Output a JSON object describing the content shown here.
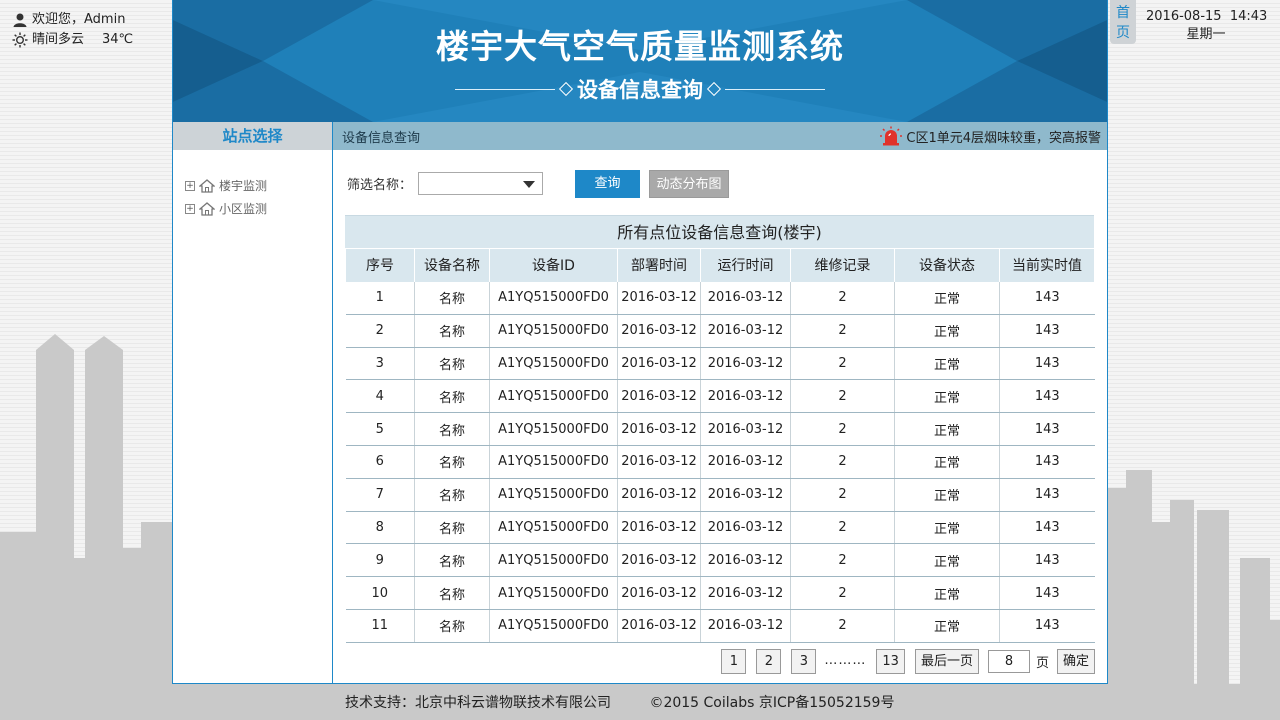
{
  "user": {
    "greeting": "欢迎您，Admin",
    "weather": "晴间多云",
    "temperature": "34℃"
  },
  "clock": {
    "datetime": "2016-08-15  14:43",
    "weekday": "星期一"
  },
  "home_button": {
    "line1": "首",
    "line2": "页"
  },
  "banner": {
    "title": "楼宇大气空气质量监测系统",
    "subtitle": "设备信息查询"
  },
  "sidebar": {
    "title": "站点选择",
    "items": [
      {
        "label": "楼宇监测"
      },
      {
        "label": "小区监测"
      }
    ]
  },
  "main": {
    "header_title": "设备信息查询",
    "alarm_text": "C区1单元4层烟味较重，突高报警",
    "filter_label": "筛选名称：",
    "filter_value": "",
    "query_button": "查询",
    "map_button": "动态分布图",
    "table_title": "所有点位设备信息查询(楼宇)",
    "columns": [
      "序号",
      "设备名称",
      "设备ID",
      "部署时间",
      "运行时间",
      "维修记录",
      "设备状态",
      "当前实时值"
    ],
    "rows": [
      [
        "1",
        "名称",
        "A1YQ515000FD0",
        "2016-03-12",
        "2016-03-12",
        "2",
        "正常",
        "143"
      ],
      [
        "2",
        "名称",
        "A1YQ515000FD0",
        "2016-03-12",
        "2016-03-12",
        "2",
        "正常",
        "143"
      ],
      [
        "3",
        "名称",
        "A1YQ515000FD0",
        "2016-03-12",
        "2016-03-12",
        "2",
        "正常",
        "143"
      ],
      [
        "4",
        "名称",
        "A1YQ515000FD0",
        "2016-03-12",
        "2016-03-12",
        "2",
        "正常",
        "143"
      ],
      [
        "5",
        "名称",
        "A1YQ515000FD0",
        "2016-03-12",
        "2016-03-12",
        "2",
        "正常",
        "143"
      ],
      [
        "6",
        "名称",
        "A1YQ515000FD0",
        "2016-03-12",
        "2016-03-12",
        "2",
        "正常",
        "143"
      ],
      [
        "7",
        "名称",
        "A1YQ515000FD0",
        "2016-03-12",
        "2016-03-12",
        "2",
        "正常",
        "143"
      ],
      [
        "8",
        "名称",
        "A1YQ515000FD0",
        "2016-03-12",
        "2016-03-12",
        "2",
        "正常",
        "143"
      ],
      [
        "9",
        "名称",
        "A1YQ515000FD0",
        "2016-03-12",
        "2016-03-12",
        "2",
        "正常",
        "143"
      ],
      [
        "10",
        "名称",
        "A1YQ515000FD0",
        "2016-03-12",
        "2016-03-12",
        "2",
        "正常",
        "143"
      ],
      [
        "11",
        "名称",
        "A1YQ515000FD0",
        "2016-03-12",
        "2016-03-12",
        "2",
        "正常",
        "143"
      ]
    ],
    "pagination": {
      "pages": [
        "1",
        "2",
        "3"
      ],
      "ellipsis": "………",
      "last_page_number": "13",
      "last_page_button": "最后一页",
      "page_input_value": "8",
      "page_unit": "页",
      "confirm_button": "确定"
    }
  },
  "footer": {
    "support": "技术支持：北京中科云谱物联技术有限公司",
    "copyright": "©2015 Coilabs 京ICP备15052159号"
  },
  "colors": {
    "accent": "#1e88c8",
    "banner_dark": "#1a6fa6",
    "header_bar": "#8fb9cc",
    "table_head": "#d9e7ee",
    "alarm_red": "#e0322b"
  }
}
